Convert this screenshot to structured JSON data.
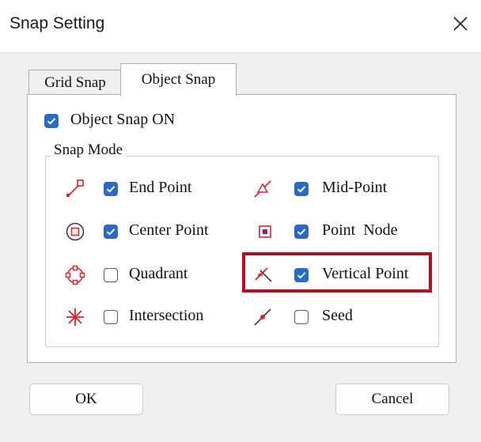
{
  "window": {
    "title": "Snap Setting",
    "close_icon": "close-icon"
  },
  "tabs": [
    {
      "label": "Grid Snap",
      "active": false
    },
    {
      "label": "Object Snap",
      "active": true
    }
  ],
  "object_snap_on": {
    "label": "Object Snap ON",
    "checked": true
  },
  "snap_mode": {
    "title": "Snap Mode",
    "items": [
      {
        "label": "End Point",
        "checked": true,
        "icon": "end-point-icon"
      },
      {
        "label": "Mid-Point",
        "checked": true,
        "icon": "mid-point-icon"
      },
      {
        "label": "Center Point",
        "checked": true,
        "icon": "center-point-icon"
      },
      {
        "label": "Point  Node",
        "checked": true,
        "icon": "point-node-icon"
      },
      {
        "label": "Quadrant",
        "checked": false,
        "icon": "quadrant-icon"
      },
      {
        "label": "Vertical Point",
        "checked": true,
        "icon": "vertical-point-icon",
        "highlighted": true
      },
      {
        "label": "Intersection",
        "checked": false,
        "icon": "intersection-icon"
      },
      {
        "label": "Seed",
        "checked": false,
        "icon": "seed-icon"
      }
    ]
  },
  "buttons": {
    "ok": "OK",
    "cancel": "Cancel"
  },
  "colors": {
    "accent": "#2a6ac4",
    "highlight": "#b0101c",
    "icon_red": "#e0202a"
  }
}
